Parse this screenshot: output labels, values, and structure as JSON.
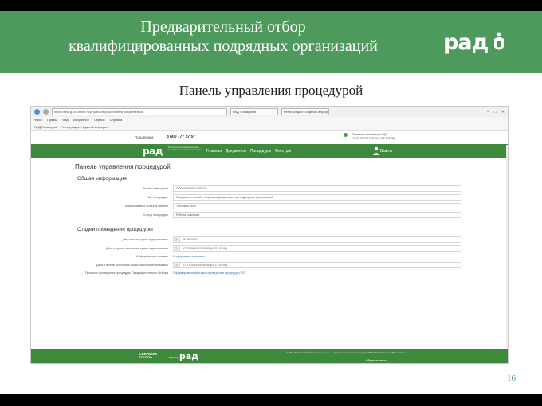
{
  "slide": {
    "title_line1": "Предварительный отбор",
    "title_line2": "квалифицированных подрядных организаций",
    "subtitle": "Панель управления процедурой",
    "logo": "рад",
    "page_number": "16"
  },
  "browser": {
    "url": "https://test-g.lot-online.ru/procedure/procedure/show/preselect/...",
    "tabs": [
      "РАД Госзакупки",
      "Регистрация в Единой информ..."
    ],
    "menu": [
      "Файл",
      "Правка",
      "Вид",
      "Избранное",
      "Сервис",
      "Справка"
    ],
    "favorites": [
      "РАД Госзакупки",
      "Регистрация в Единой информ..."
    ]
  },
  "site": {
    "support_label": "Поддержка",
    "phone": "8 800 777 57 57",
    "account_line1": "Тестовая организация РАД",
    "account_line2": "16.07.2019 17:00:00 (UTC+03:00)",
    "logo": "рад",
    "logo_sub": "Российский аукционный дом — электронная торговая площадка",
    "nav": [
      "Главная",
      "Документы",
      "Процедуры",
      "Реестры"
    ],
    "logout": "Выйти"
  },
  "panel": {
    "heading": "Панель управления процедурой",
    "general_heading": "Общая информация",
    "general_fields": [
      {
        "label": "Номер извещения",
        "value": "ПО0400000341900025"
      },
      {
        "label": "Тип процедуры",
        "value": "Предварительный отбор квалифицированных подрядных организаций"
      },
      {
        "label": "Наименование объекта закупки",
        "value": "Тестовая 2609"
      },
      {
        "label": "Статус процедуры",
        "value": "Работа комиссии"
      }
    ],
    "stages_heading": "Стадии проведения процедуры",
    "stage_fields": [
      {
        "label": "Дата начала срока подачи заявок",
        "value": "26.06.2019"
      },
      {
        "label": "Дата и время окончания срока подачи заявок",
        "value": "17.07.2019 17:00:00 (UTC+03:00)"
      },
      {
        "label": "Информация о заявках",
        "link": "Информация о заявках"
      },
      {
        "label": "Дата и время окончания срока рассмотрения заявок",
        "value": "17.07.2019 18:00:00 (UTC+03:00)"
      },
      {
        "label": "Протокол проведения процедуры Предварительного Отбора",
        "link": "Сформировать протокол проведения процедуры ПО"
      }
    ]
  },
  "footer": {
    "bank": "СБЕРБАНК",
    "bank_sub": "ГРУППА",
    "partner": "партнер",
    "logo": "рад",
    "copyright": "© 2009-2019 Российский аукционный дом — электронная торговая площадка. 8 800 777 57 57 support@lot-online.ru",
    "feedback": "Обратная связь"
  },
  "colors": {
    "slide_green": "#4e9a5d",
    "site_green": "#3d8a3d",
    "link_blue": "#2b6fb3"
  }
}
